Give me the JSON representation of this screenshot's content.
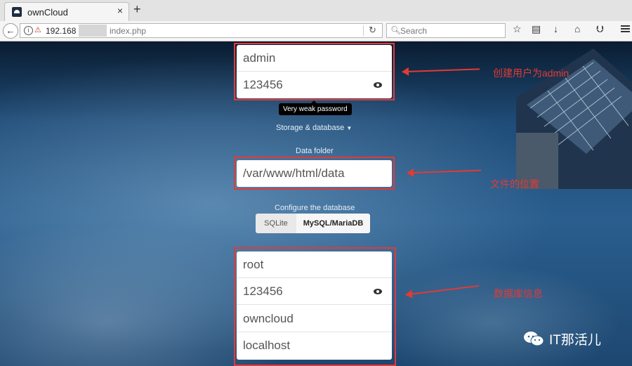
{
  "browser": {
    "tab_title": "ownCloud",
    "tab_close": "×",
    "new_tab": "+",
    "url_host": "192.168",
    "url_path": "index.php",
    "search_placeholder": "Search"
  },
  "form": {
    "admin_user": "admin",
    "admin_password": "123456",
    "password_strength": "Very weak password",
    "storage_toggle": "Storage & database",
    "data_folder_label": "Data folder",
    "data_folder": "/var/www/html/data",
    "configure_db_label": "Configure the database",
    "db_options": [
      "SQLite",
      "MySQL/MariaDB"
    ],
    "db_selected": "MySQL/MariaDB",
    "db_user": "root",
    "db_password": "123456",
    "db_name": "owncloud",
    "db_host": "localhost"
  },
  "annotations": {
    "admin_note": "创建用户为admin",
    "folder_note": "文件的位置",
    "db_note": "数据库信息"
  },
  "watermark": "IT那活儿",
  "colors": {
    "annotation": "#e53935",
    "ui_accent": "#1d2d44"
  }
}
